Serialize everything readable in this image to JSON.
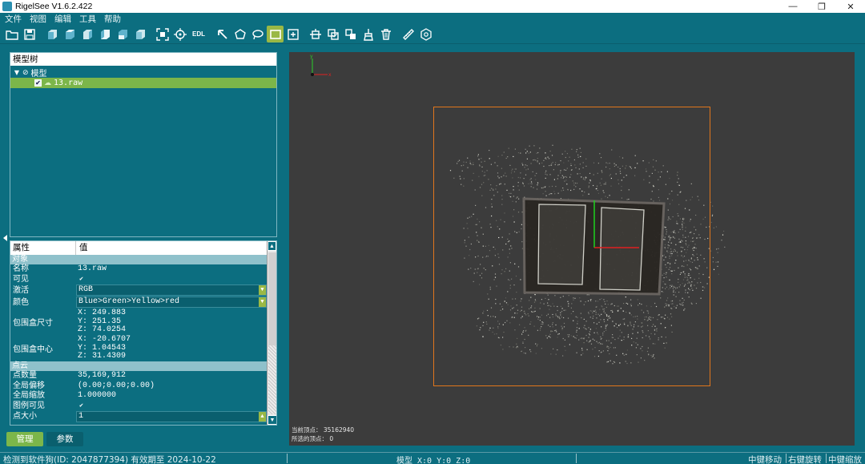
{
  "window": {
    "title": "RigelSee V1.6.2.422",
    "controls": [
      "—",
      "❐",
      "✕"
    ]
  },
  "menu": [
    "文件",
    "视图",
    "编辑",
    "工具",
    "帮助"
  ],
  "toolbar": {
    "buttons": [
      "open-folder-icon",
      "save-icon",
      "view-front-icon",
      "view-back-icon",
      "view-left-icon",
      "view-right-icon",
      "view-top-icon",
      "view-bottom-icon",
      "fit-view-icon",
      "center-target-icon",
      "edl-icon",
      "pointer-icon",
      "polygon-select-icon",
      "lasso-select-icon",
      "rect-select-icon",
      "add-box-icon",
      "split-icon",
      "merge-icon",
      "export-selection-icon",
      "clean-icon",
      "delete-icon",
      "measure-icon",
      "settings-cube-icon"
    ],
    "edl_label": "EDL",
    "active_tool": "rect-select-icon"
  },
  "tree": {
    "header": "模型树",
    "root_label": "模型",
    "child_label": "13.raw"
  },
  "properties": {
    "col_attr": "属性",
    "col_value": "值",
    "section_object": "对象",
    "name_label": "名称",
    "name_value": "13.raw",
    "visible_label": "可见",
    "activate_label": "激活",
    "activate_value": "RGB",
    "color_label": "颜色",
    "color_value": "Blue>Green>Yellow>red",
    "bbox_size_label": "包围盒尺寸",
    "bbox_size": [
      "X: 249.883",
      "Y: 251.35",
      "Z: 74.0254"
    ],
    "bbox_center_label": "包围盒中心",
    "bbox_center": [
      "X: -20.6707",
      "Y: 1.04543",
      "Z: 31.4309"
    ],
    "section_cloud": "点云",
    "point_count_label": "点数量",
    "point_count": "35,169,912",
    "global_shift_label": "全局偏移",
    "global_shift": "(0.00;0.00;0.00)",
    "global_scale_label": "全局缩放",
    "global_scale": "1.000000",
    "legend_visible_label": "图例可见",
    "point_size_label": "点大小",
    "point_size": "1"
  },
  "tabs": {
    "manage": "管理",
    "params": "参数"
  },
  "viewport": {
    "current_vertex_label": "当前顶点：",
    "current_vertex_value": "35162940",
    "selected_vertex_label": "所选的顶点：",
    "selected_vertex_value": "0",
    "axis_x": "x",
    "axis_y": "y",
    "colors": {
      "bg": "#3c3c3c",
      "bbox": "#e0761c"
    }
  },
  "status": {
    "license": "检测到软件狗(ID: 2047877394) 有效期至 2024-10-22",
    "coords": "模型 X:0 Y:0 Z:0",
    "mid_move": "中键移动",
    "right_rotate": "右键旋转",
    "mid_zoom": "中键缩放"
  },
  "colors": {
    "main": "#0c6e80",
    "accent": "#7cb64a",
    "section": "#8fc1cb"
  }
}
